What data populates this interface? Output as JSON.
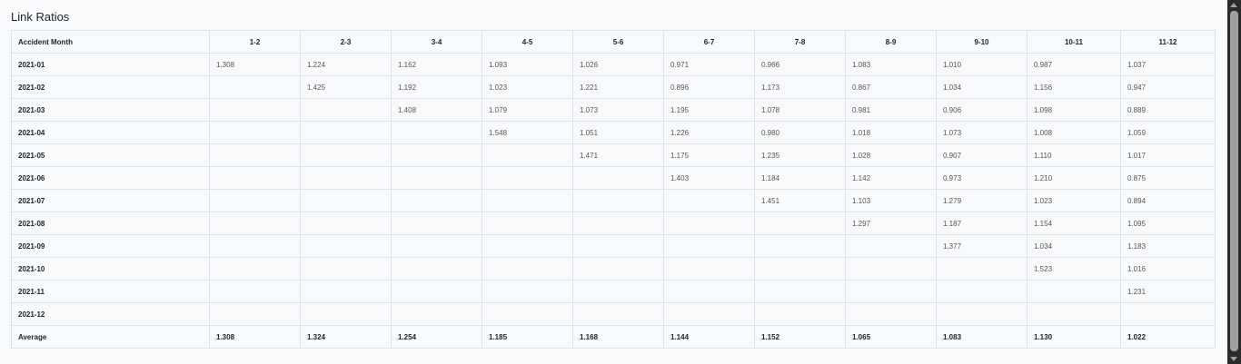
{
  "title": "Link Ratios",
  "table": {
    "header_first": "Accident Month",
    "columns": [
      "1-2",
      "2-3",
      "3-4",
      "4-5",
      "5-6",
      "6-7",
      "7-8",
      "8-9",
      "9-10",
      "10-11",
      "11-12"
    ],
    "rows": [
      {
        "month": "2021-01",
        "values": [
          "1.308",
          "1.224",
          "1.162",
          "1.093",
          "1.026",
          "0.971",
          "0.966",
          "1.083",
          "1.010",
          "0.987",
          "1.037"
        ]
      },
      {
        "month": "2021-02",
        "values": [
          "",
          "1.425",
          "1.192",
          "1.023",
          "1.221",
          "0.896",
          "1.173",
          "0.867",
          "1.034",
          "1.156",
          "0.947"
        ]
      },
      {
        "month": "2021-03",
        "values": [
          "",
          "",
          "1.408",
          "1.079",
          "1.073",
          "1.195",
          "1.078",
          "0.981",
          "0.906",
          "1.098",
          "0.889"
        ]
      },
      {
        "month": "2021-04",
        "values": [
          "",
          "",
          "",
          "1.548",
          "1.051",
          "1.226",
          "0.980",
          "1.018",
          "1.073",
          "1.008",
          "1.059"
        ]
      },
      {
        "month": "2021-05",
        "values": [
          "",
          "",
          "",
          "",
          "1.471",
          "1.175",
          "1.235",
          "1.028",
          "0.907",
          "1.110",
          "1.017"
        ]
      },
      {
        "month": "2021-06",
        "values": [
          "",
          "",
          "",
          "",
          "",
          "1.403",
          "1.184",
          "1.142",
          "0.973",
          "1.210",
          "0.875"
        ]
      },
      {
        "month": "2021-07",
        "values": [
          "",
          "",
          "",
          "",
          "",
          "",
          "1.451",
          "1.103",
          "1.279",
          "1.023",
          "0.894"
        ]
      },
      {
        "month": "2021-08",
        "values": [
          "",
          "",
          "",
          "",
          "",
          "",
          "",
          "1.297",
          "1.187",
          "1.154",
          "1.095"
        ]
      },
      {
        "month": "2021-09",
        "values": [
          "",
          "",
          "",
          "",
          "",
          "",
          "",
          "",
          "1.377",
          "1.034",
          "1.183"
        ]
      },
      {
        "month": "2021-10",
        "values": [
          "",
          "",
          "",
          "",
          "",
          "",
          "",
          "",
          "",
          "1.523",
          "1.016"
        ]
      },
      {
        "month": "2021-11",
        "values": [
          "",
          "",
          "",
          "",
          "",
          "",
          "",
          "",
          "",
          "",
          "1.231"
        ]
      },
      {
        "month": "2021-12",
        "values": [
          "",
          "",
          "",
          "",
          "",
          "",
          "",
          "",
          "",
          "",
          ""
        ]
      }
    ],
    "average": {
      "label": "Average",
      "values": [
        "1.308",
        "1.324",
        "1.254",
        "1.185",
        "1.168",
        "1.144",
        "1.152",
        "1.065",
        "1.083",
        "1.130",
        "1.022"
      ]
    }
  },
  "icons": {
    "scroll_up": "arrow-up-icon",
    "scroll_down": "arrow-down-icon"
  }
}
